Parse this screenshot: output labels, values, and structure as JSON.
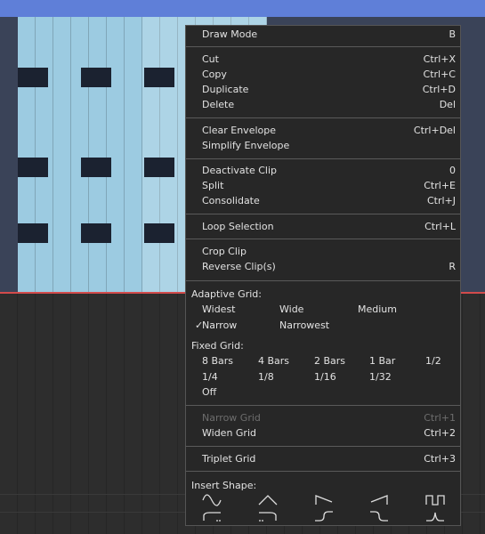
{
  "menu": {
    "items": [
      {
        "label": "Draw Mode",
        "shortcut": "B"
      },
      {
        "label": "Cut",
        "shortcut": "Ctrl+X"
      },
      {
        "label": "Copy",
        "shortcut": "Ctrl+C"
      },
      {
        "label": "Duplicate",
        "shortcut": "Ctrl+D"
      },
      {
        "label": "Delete",
        "shortcut": "Del"
      },
      {
        "label": "Clear Envelope",
        "shortcut": "Ctrl+Del"
      },
      {
        "label": "Simplify Envelope",
        "shortcut": ""
      },
      {
        "label": "Deactivate Clip",
        "shortcut": "0"
      },
      {
        "label": "Split",
        "shortcut": "Ctrl+E"
      },
      {
        "label": "Consolidate",
        "shortcut": "Ctrl+J"
      },
      {
        "label": "Loop Selection",
        "shortcut": "Ctrl+L"
      },
      {
        "label": "Crop Clip",
        "shortcut": ""
      },
      {
        "label": "Reverse Clip(s)",
        "shortcut": "R"
      },
      {
        "label": "Narrow Grid",
        "shortcut": "Ctrl+1",
        "disabled": true
      },
      {
        "label": "Widen Grid",
        "shortcut": "Ctrl+2"
      },
      {
        "label": "Triplet Grid",
        "shortcut": "Ctrl+3"
      }
    ],
    "adaptive_grid": {
      "header": "Adaptive Grid:",
      "options": [
        "Widest",
        "Wide",
        "Medium",
        "Narrow",
        "Narrowest"
      ],
      "selected": "Narrow",
      "check": "✓"
    },
    "fixed_grid": {
      "header": "Fixed Grid:",
      "options": [
        "8 Bars",
        "4 Bars",
        "2 Bars",
        "1 Bar",
        "1/2",
        "1/4",
        "1/8",
        "1/16",
        "1/32",
        "Off"
      ]
    },
    "insert_shape": {
      "header": "Insert Shape:",
      "shapes": [
        "sine-wave-icon",
        "triangle-icon",
        "sawtooth-down-icon",
        "sawtooth-up-icon",
        "square-wave-icon",
        "adsr-attack-icon",
        "adsr-release-icon",
        "s-curve-up-icon",
        "s-curve-down-icon",
        "peak-icon"
      ]
    }
  }
}
